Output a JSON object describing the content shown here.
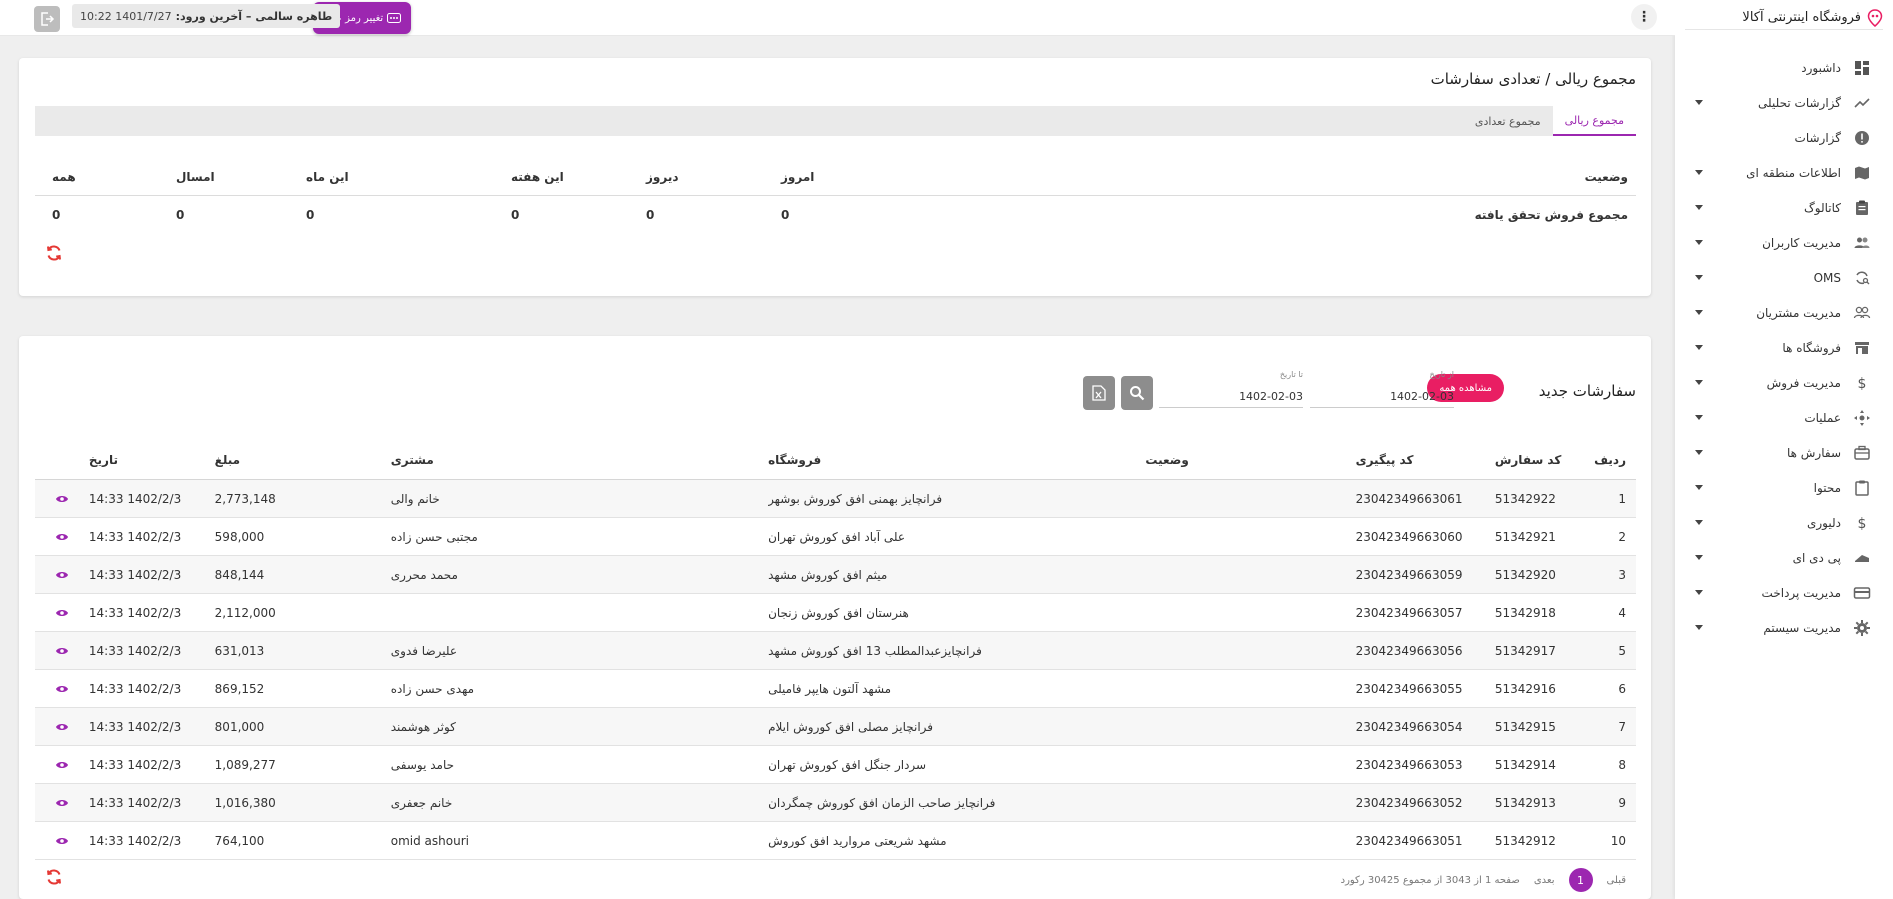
{
  "brand": {
    "name": "فروشگاه اینترنتی آکالا"
  },
  "sidebar": {
    "items": [
      {
        "label": "داشبورد",
        "icon": "dashboard-icon",
        "expandable": false
      },
      {
        "label": "گزارشات تحلیلی",
        "icon": "trend-icon",
        "expandable": true
      },
      {
        "label": "گزارشات",
        "icon": "alert-icon",
        "expandable": false
      },
      {
        "label": "اطلاعات منطقه ای",
        "icon": "map-icon",
        "expandable": true
      },
      {
        "label": "کاتالوگ",
        "icon": "clipboard-icon",
        "expandable": true
      },
      {
        "label": "مدیریت کاربران",
        "icon": "users-icon",
        "expandable": true
      },
      {
        "label": "OMS",
        "icon": "sync-search-icon",
        "expandable": true
      },
      {
        "label": "مدیریت مشتریان",
        "icon": "customers-icon",
        "expandable": true
      },
      {
        "label": "فروشگاه ها",
        "icon": "store-icon",
        "expandable": true
      },
      {
        "label": "مدیریت فروش",
        "icon": "dollar-icon",
        "expandable": true
      },
      {
        "label": "عملیات",
        "icon": "operations-icon",
        "expandable": true
      },
      {
        "label": "سفارش ها",
        "icon": "briefcase-icon",
        "expandable": true
      },
      {
        "label": "محتوا",
        "icon": "content-icon",
        "expandable": true
      },
      {
        "label": "دلیوری",
        "icon": "dollar-icon",
        "expandable": true
      },
      {
        "label": "پی دی ای",
        "icon": "pda-icon",
        "expandable": true
      },
      {
        "label": "مدیریت پرداخت",
        "icon": "card-icon",
        "expandable": true
      },
      {
        "label": "مدیریت سیستم",
        "icon": "gear-icon",
        "expandable": true
      }
    ]
  },
  "topbar": {
    "user_name": "طاهره سالمی",
    "last_login_label": "– آخرین ورود:",
    "last_login_value": "1401/7/27 10:22",
    "change_password_label": "تغییر رمز عبور"
  },
  "summary": {
    "title": "مجموع ریالی / تعدادی سفارشات",
    "tabs": [
      {
        "label": "مجموع ریالی",
        "active": true
      },
      {
        "label": "مجموع تعدادی",
        "active": false
      }
    ],
    "headers": [
      "وضعیت",
      "امروز",
      "دیروز",
      "این هفته",
      "این ماه",
      "امسال",
      "همه"
    ],
    "row": [
      "مجموع فروش تحقق یافته",
      "0",
      "0",
      "0",
      "0",
      "0",
      "0"
    ]
  },
  "orders": {
    "title": "سفارشات جدید",
    "view_all_label": "مشاهده همه",
    "from_date_label": "از تاریخ",
    "from_date_value": "1402-02-03",
    "to_date_label": "تا تاریخ",
    "to_date_value": "1402-02-03",
    "headers": [
      "ردیف",
      "کد سفارش",
      "کد پیگیری",
      "وضعیت",
      "فروشگاه",
      "مشتری",
      "مبلغ",
      "تاریخ"
    ],
    "rows": [
      [
        "1",
        "51342922",
        "23042349663061",
        "",
        "فرانچایز بهمنی افق کوروش بوشهر",
        "خانم والی",
        "2,773,148",
        "1402/2/3 14:33"
      ],
      [
        "2",
        "51342921",
        "23042349663060",
        "",
        "علی آباد افق کوروش تهران",
        "مجتبی حسن زاده",
        "598,000",
        "1402/2/3 14:33"
      ],
      [
        "3",
        "51342920",
        "23042349663059",
        "",
        "میثم افق کوروش مشهد",
        "محمد محرری",
        "848,144",
        "1402/2/3 14:33"
      ],
      [
        "4",
        "51342918",
        "23042349663057",
        "",
        "هنرستان افق کوروش زنجان",
        "",
        "2,112,000",
        "1402/2/3 14:33"
      ],
      [
        "5",
        "51342917",
        "23042349663056",
        "",
        "فرانچایزعبدالمطلب 13 افق کوروش مشهد",
        "علیرضا فدوی",
        "631,013",
        "1402/2/3 14:33"
      ],
      [
        "6",
        "51342916",
        "23042349663055",
        "",
        "مشهد آلتون هایپر فامیلی",
        "مهدی حسن زاده",
        "869,152",
        "1402/2/3 14:33"
      ],
      [
        "7",
        "51342915",
        "23042349663054",
        "",
        "فرانچایز مصلی افق کوروش ایلام",
        "کوثر هوشمند",
        "801,000",
        "1402/2/3 14:33"
      ],
      [
        "8",
        "51342914",
        "23042349663053",
        "",
        "سردار جنگل افق کوروش تهران",
        "حامد یوسفی",
        "1,089,277",
        "1402/2/3 14:33"
      ],
      [
        "9",
        "51342913",
        "23042349663052",
        "",
        "فرانچایز صاحب الزمان افق کوروش چمگردان",
        "خانم جعفری",
        "1,016,380",
        "1402/2/3 14:33"
      ],
      [
        "10",
        "51342912",
        "23042349663051",
        "",
        "مشهد شریعتی مروارید افق کوروش",
        "omid ashouri",
        "764,100",
        "1402/2/3 14:33"
      ]
    ],
    "pagination": {
      "prev_label": "قبلی",
      "current_page": "1",
      "next_label": "بعدی",
      "info": "صفحه 1 از 3043 از مجموع 30425 رکورد"
    }
  },
  "colors": {
    "accent": "#9c27b0",
    "pink": "#e91e63",
    "refresh": "#e53935"
  }
}
